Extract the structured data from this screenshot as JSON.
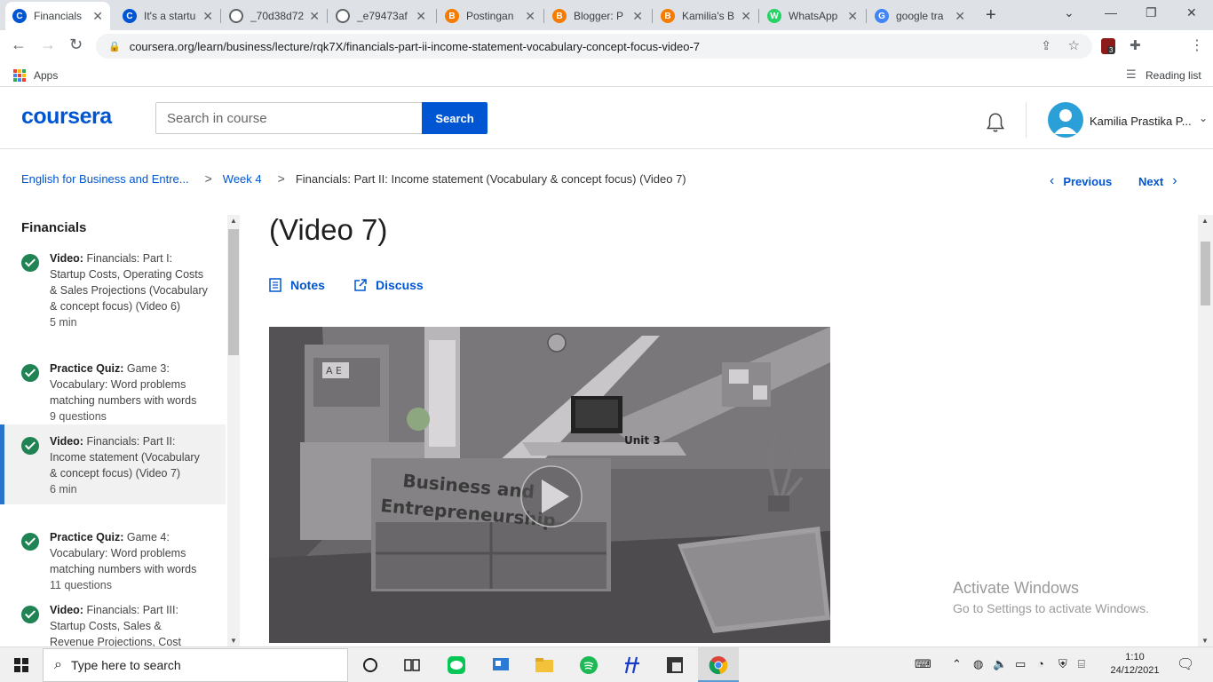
{
  "browser": {
    "tabs": [
      {
        "title": "Financials",
        "favicon": "C",
        "color": "#0056d2",
        "active": true
      },
      {
        "title": "It's a startu",
        "favicon": "C",
        "color": "#0056d2"
      },
      {
        "title": "_70d38d72",
        "favicon": "globe",
        "color": "#5f6368"
      },
      {
        "title": "_e79473af",
        "favicon": "globe",
        "color": "#5f6368"
      },
      {
        "title": "Postingan",
        "favicon": "B",
        "color": "#f57c00"
      },
      {
        "title": "Blogger: P",
        "favicon": "B",
        "color": "#f57c00"
      },
      {
        "title": "Kamilia's B",
        "favicon": "B",
        "color": "#f57c00"
      },
      {
        "title": "WhatsApp",
        "favicon": "W",
        "color": "#25d366"
      },
      {
        "title": "google tra",
        "favicon": "G",
        "color": "#4285f4"
      }
    ],
    "url": "coursera.org/learn/business/lecture/rqk7X/financials-part-ii-income-statement-vocabulary-concept-focus-video-7",
    "bookmarks": {
      "apps": "Apps",
      "reading_list": "Reading list"
    },
    "extension_badge": "3"
  },
  "header": {
    "logo": "coursera",
    "search_placeholder": "Search in course",
    "search_button": "Search",
    "user_name": "Kamilia Prastika P..."
  },
  "breadcrumb": {
    "course": "English for Business and Entre...",
    "week": "Week 4",
    "current": "Financials: Part II: Income statement (Vocabulary & concept focus) (Video 7)"
  },
  "nav": {
    "previous": "Previous",
    "next": "Next"
  },
  "sidebar": {
    "title": "Financials",
    "items": [
      {
        "kind": "Video:",
        "text": "Financials: Part I: Startup Costs, Operating Costs & Sales Projections (Vocabulary & concept focus) (Video 6)",
        "meta": "5 min"
      },
      {
        "kind": "Practice Quiz:",
        "text": "Game 3: Vocabulary: Word problems matching numbers with words",
        "meta": "9 questions"
      },
      {
        "kind": "Video:",
        "text": "Financials: Part II: Income statement (Vocabulary & concept focus) (Video 7)",
        "meta": "6 min",
        "active": true
      },
      {
        "kind": "Practice Quiz:",
        "text": "Game 4: Vocabulary: Word problems matching numbers with words",
        "meta": "11 questions"
      },
      {
        "kind": "Video:",
        "text": "Financials: Part III: Startup Costs, Sales & Revenue Projections, Cost Projections &",
        "meta": ""
      }
    ]
  },
  "main": {
    "title": "(Video 7)",
    "notes": "Notes",
    "discuss": "Discuss",
    "video_text": {
      "sign1": "Business and",
      "sign2": "Entrepreneurship",
      "unit": "Unit 3",
      "book": "A E"
    }
  },
  "watermark": {
    "line1": "Activate Windows",
    "line2": "Go to Settings to activate Windows."
  },
  "taskbar": {
    "search_placeholder": "Type here to search",
    "time": "1:10",
    "date": "24/12/2021"
  }
}
